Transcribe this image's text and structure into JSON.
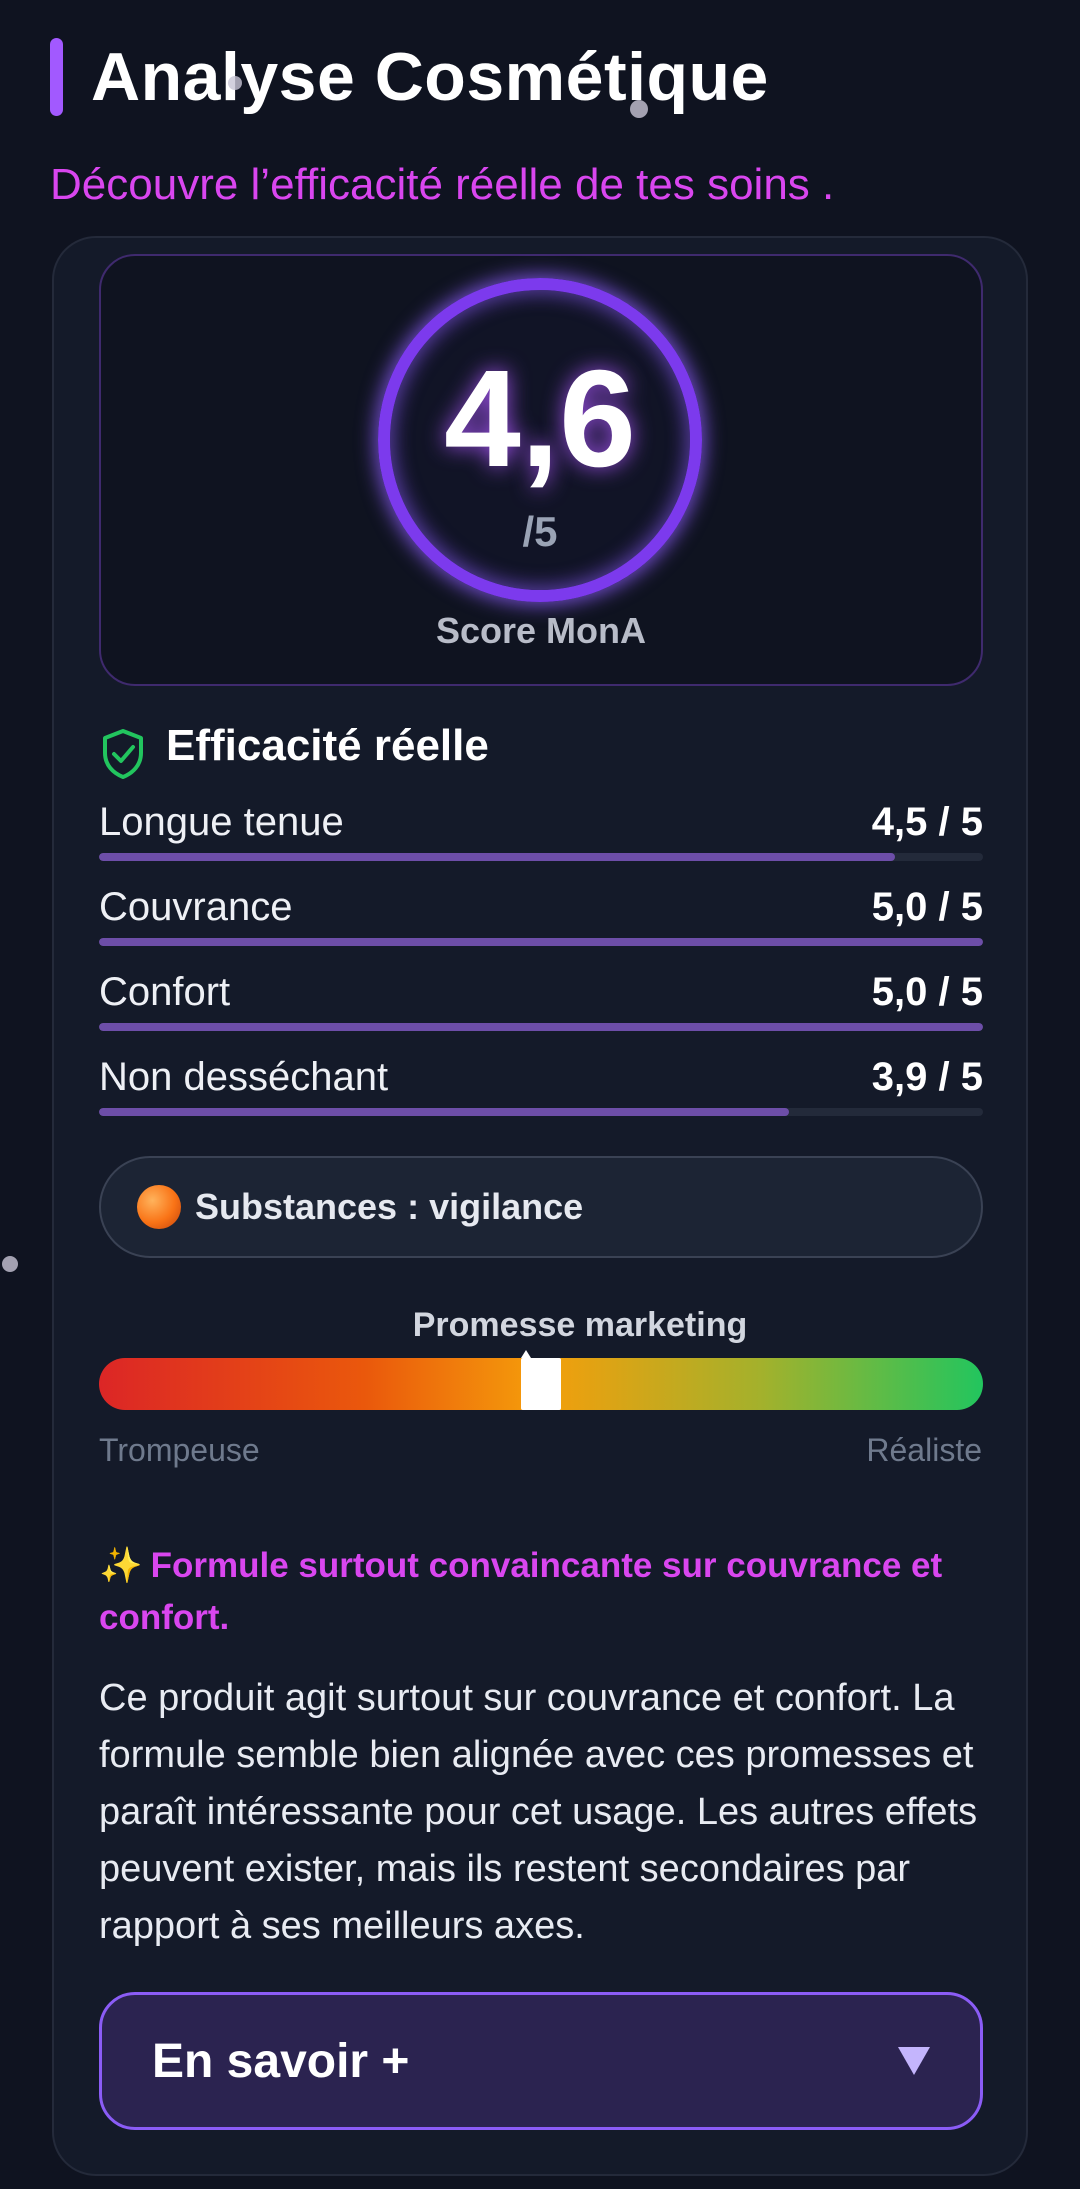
{
  "header": {
    "title": "Analyse Cosmétique",
    "subtitle": "Découvre l’efficacité réelle de tes soins ."
  },
  "score": {
    "value": "4,6",
    "max": "/5",
    "label": "Score MonA"
  },
  "efficacy": {
    "title": "Efficacité réelle",
    "metrics": [
      {
        "label": "Longue tenue",
        "value": "4,5 / 5",
        "fraction": 0.9
      },
      {
        "label": "Couvrance",
        "value": "5,0 / 5",
        "fraction": 1.0
      },
      {
        "label": "Confort",
        "value": "5,0 / 5",
        "fraction": 1.0
      },
      {
        "label": "Non desséchant",
        "value": "3,9 / 5",
        "fraction": 0.78
      }
    ]
  },
  "substances": {
    "icon": "orange-circle-icon",
    "text": "Substances : vigilance"
  },
  "marketing": {
    "title": "Promesse marketing",
    "left_label": "Trompeuse",
    "right_label": "Réaliste",
    "position": 0.5
  },
  "summary": {
    "highlight": "Formule surtout convaincante sur couvrance et confort.",
    "sparkle": "✨",
    "text": "Ce produit agit surtout sur couvrance et confort. La formule semble bien alignée avec ces promesses et paraît intéressante pour cet usage. Les autres effets peuvent exister, mais ils restent secondaires par rapport à ses meilleurs axes."
  },
  "more": {
    "label": "En savoir +"
  },
  "colors": {
    "accent": "#a259ff",
    "highlight": "#d946ef",
    "background": "#0f1320",
    "bar_fill": "#6d4ea8"
  }
}
